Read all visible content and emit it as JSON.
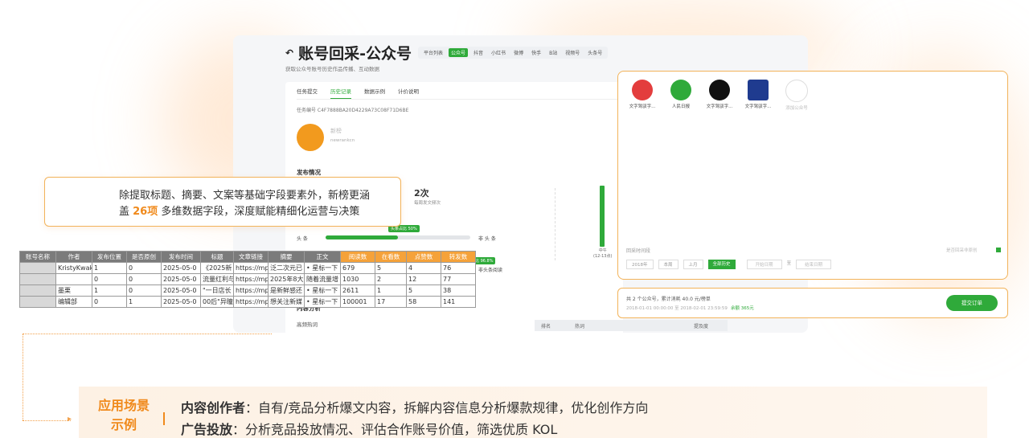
{
  "app": {
    "title": "账号回采-公众号",
    "subtitle": "获取公众号账号历史作品传播、互动数据",
    "platforms": [
      "平台列表",
      "公众号",
      "抖音",
      "小红书",
      "微博",
      "快手",
      "B站",
      "视频号",
      "头条号"
    ],
    "tabs": [
      "任务提交",
      "历史记录",
      "数据示例",
      "计价说明"
    ],
    "task_id": "任务编号  C4F7888BA20D4229A73C08F71D6BE",
    "account_name": "新榜",
    "account_sub": "newrankcn",
    "section_publish": "发布情况",
    "times": "2次",
    "times_label": "每周发文频次",
    "stat_tag_1": "头条占比 50%",
    "stat_tag_2": "头条阅读占比 96.8%",
    "bar1_left": "头  条",
    "bar1_right": "非 头 条",
    "bar2_right": "非头条阅读",
    "chart_label": "中午\n(12-13点)",
    "section_content": "内容分析",
    "section_hot": "高频热词",
    "hot_table_headers": [
      "排名",
      "热词",
      "提及度"
    ]
  },
  "accounts": [
    {
      "label": "文字驾驭字...",
      "color": "#e33d3d"
    },
    {
      "label": "人民日报",
      "color": "#2faa3a"
    },
    {
      "label": "文字驾驭字...",
      "color": "#111111"
    },
    {
      "label": "文字驾驭字...",
      "color": "#1f3b8f"
    },
    {
      "label": "添加公众号",
      "color": "#eeeeee"
    }
  ],
  "filters": {
    "time_label": "回采时间段",
    "buttons": [
      "2018年",
      "本周",
      "上月",
      "全部历史"
    ],
    "start": "开始日期",
    "to": "至",
    "end": "结束日期",
    "check_label": "是否回采非原创"
  },
  "order": {
    "summary": "共 2 个公众号，累计消耗 40.0 元/榜单",
    "range": "2018-01-01 00:00:00 至 2018-02-01 23:59:59",
    "remain": "余额 365元",
    "submit": "提交订单"
  },
  "callout": {
    "line1": "除提取标题、摘要、文案等基础字段要素外，新榜更涵",
    "line2_pre": "盖 ",
    "line2_hl": "26项",
    "line2_post": " 多维数据字段，深度赋能精细化运营与决策"
  },
  "table": {
    "headers": [
      "账号名称",
      "作者",
      "发布位置",
      "是否原创",
      "发布时间",
      "标题",
      "文章链接",
      "摘要",
      "正文",
      "阅读数",
      "在看数",
      "点赞数",
      "转发数"
    ],
    "rows": [
      [
        "",
        "KristyKwak",
        "1",
        "0",
        "2025-05-0",
        "《2025新",
        "https://mp",
        "泛二次元已",
        "• 星标一下",
        "679",
        "5",
        "4",
        "76"
      ],
      [
        "",
        "",
        "0",
        "0",
        "2025-05-0",
        "流量红利与",
        "https://mp",
        "2025年8大",
        "随着流量增",
        "1030",
        "2",
        "12",
        "77"
      ],
      [
        "",
        "墨栗",
        "1",
        "0",
        "2025-05-0",
        "\"一日店长",
        "https://mp",
        "是新鲜感还",
        "• 星标一下",
        "2611",
        "1",
        "5",
        "38"
      ],
      [
        "",
        "编辑部",
        "0",
        "1",
        "2025-05-0",
        "00后\"异瞳",
        "https://mp",
        "想关注新媒",
        "• 星标一下",
        "100001",
        "17",
        "58",
        "141"
      ]
    ]
  },
  "bottom": {
    "scenario_l1": "应用场景",
    "scenario_l2": "示例",
    "line1_bold": "内容创作者",
    "line1_text": "：自有/竞品分析爆文内容，拆解内容信息分析爆款规律，优化创作方向",
    "line2_bold": "广告投放",
    "line2_text": "：分析竞品投放情况、评估合作账号价值，筛选优质 KOL"
  },
  "colors": {
    "accent": "#f08a1c",
    "green": "#2faa3a",
    "border": "#f2b35a"
  }
}
